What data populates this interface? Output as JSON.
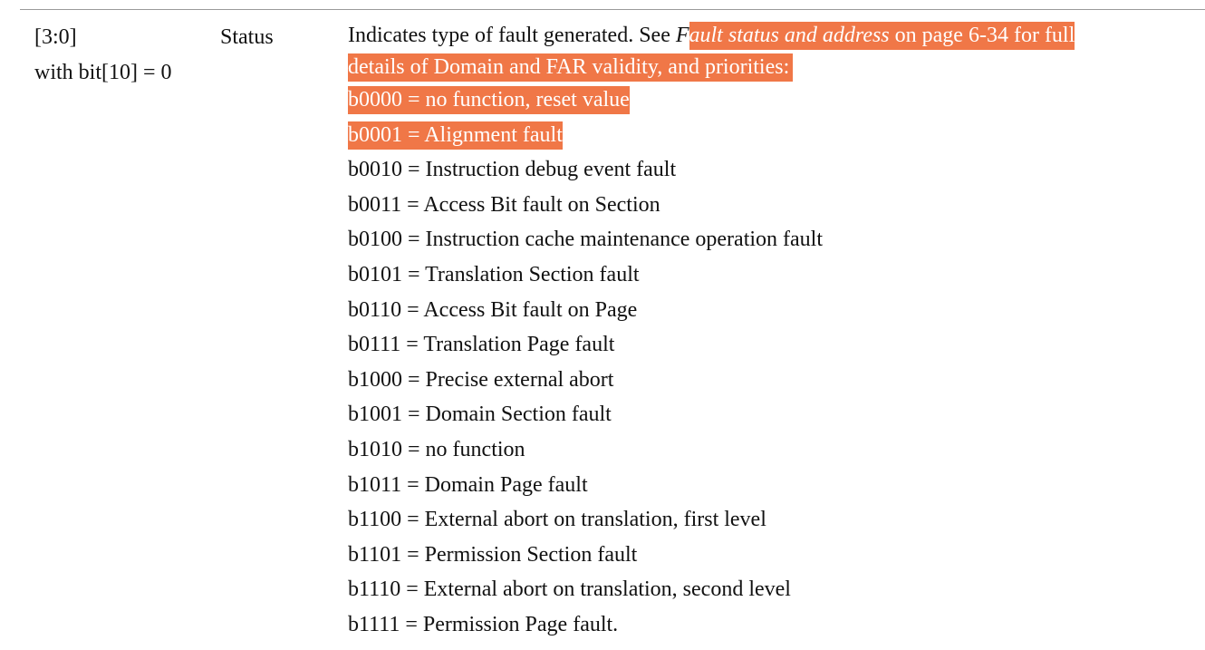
{
  "field": {
    "bits": "[3:0]",
    "condition": "with bit[10] = 0",
    "name": "Status"
  },
  "description": {
    "prefix": "Indicates type of fault generated. See ",
    "link_first_letter": "F",
    "link_rest": "ault status and address",
    "suffix": " on page 6-34 for full",
    "line2": "details of Domain and FAR validity, and priorities:"
  },
  "encodings": [
    {
      "code": "b0000",
      "desc": "no function, reset value",
      "highlighted": true
    },
    {
      "code": "b0001",
      "desc": "Alignment fault",
      "highlighted": true
    },
    {
      "code": "b0010",
      "desc": "Instruction debug event fault",
      "highlighted": false
    },
    {
      "code": "b0011",
      "desc": "Access Bit fault on Section",
      "highlighted": false
    },
    {
      "code": "b0100",
      "desc": "Instruction cache maintenance operation fault",
      "highlighted": false
    },
    {
      "code": "b0101",
      "desc": "Translation Section fault",
      "highlighted": false
    },
    {
      "code": "b0110",
      "desc": "Access Bit fault on Page",
      "highlighted": false
    },
    {
      "code": "b0111",
      "desc": "Translation Page fault",
      "highlighted": false
    },
    {
      "code": "b1000",
      "desc": "Precise external abort",
      "highlighted": false
    },
    {
      "code": "b1001",
      "desc": "Domain Section fault",
      "highlighted": false
    },
    {
      "code": "b1010",
      "desc": "no function",
      "highlighted": false
    },
    {
      "code": "b1011",
      "desc": "Domain Page fault",
      "highlighted": false
    },
    {
      "code": "b1100",
      "desc": "External abort on translation, first level",
      "highlighted": false
    },
    {
      "code": "b1101",
      "desc": "Permission Section fault",
      "highlighted": false
    },
    {
      "code": "b1110",
      "desc": "External abort on translation, second level",
      "highlighted": false
    },
    {
      "code": "b1111",
      "desc": "Permission Page fault.",
      "highlighted": false
    }
  ],
  "equals_sign": " = ",
  "colors": {
    "highlight": "#f07747",
    "rule": "#9a9a9a",
    "text": "#111111"
  }
}
